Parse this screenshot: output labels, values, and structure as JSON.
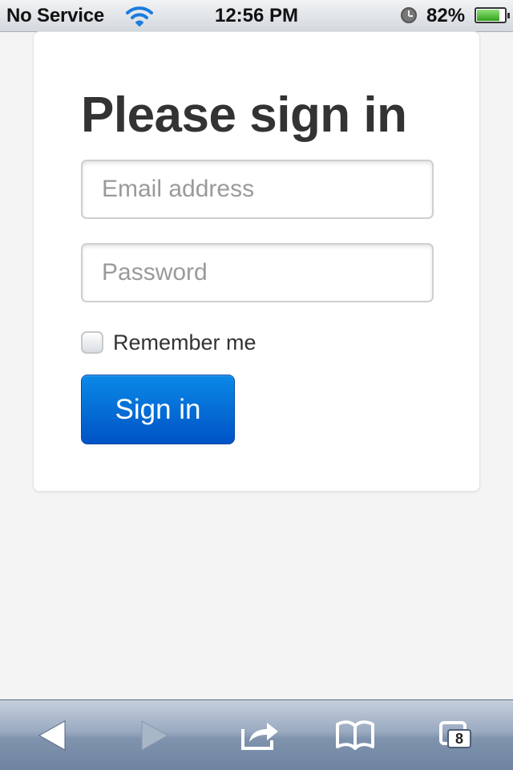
{
  "status_bar": {
    "carrier": "No Service",
    "time": "12:56 PM",
    "battery_percent": "82%",
    "battery_level": 0.82,
    "icons": [
      "wifi-icon",
      "alarm-clock-icon",
      "battery-icon"
    ]
  },
  "form": {
    "title": "Please sign in",
    "email_placeholder": "Email address",
    "email_value": "",
    "password_placeholder": "Password",
    "password_value": "",
    "remember_label": "Remember me",
    "remember_checked": false,
    "submit_label": "Sign in"
  },
  "toolbar": {
    "items": [
      "back-arrow-icon",
      "forward-arrow-icon",
      "share-icon",
      "bookmarks-icon",
      "pages-icon"
    ],
    "tab_count": "8"
  },
  "colors": {
    "page_background": "#f4f4f4",
    "button_primary": "#0a6fd8",
    "title_text": "#333333"
  }
}
